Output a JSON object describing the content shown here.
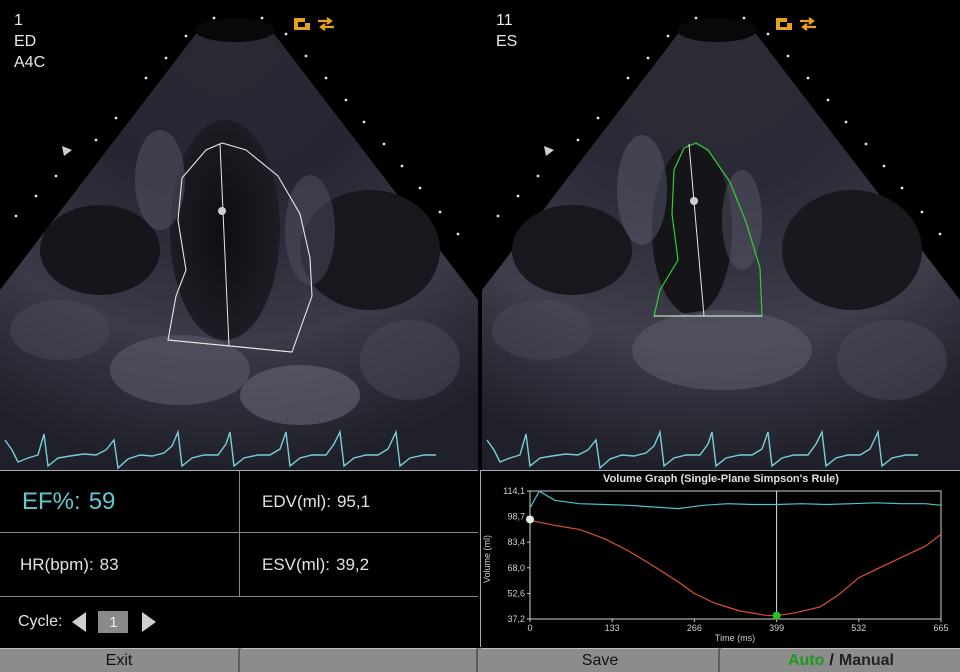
{
  "left_view": {
    "frame": "1",
    "phase": "ED",
    "view": "A4C"
  },
  "right_view": {
    "frame": "11",
    "phase": "ES"
  },
  "icons": {
    "probe": "probe-orientation-icon",
    "flip": "flip-swap-icon",
    "marker": "orientation-marker-icon"
  },
  "results": {
    "ef_label": "EF%:",
    "ef_value": "59",
    "edv_label": "EDV(ml):",
    "edv_value": "95,1",
    "hr_label": "HR(bpm):",
    "hr_value": "83",
    "esv_label": "ESV(ml):",
    "esv_value": "39,2"
  },
  "cycle": {
    "label": "Cycle:",
    "value": "1"
  },
  "graph": {
    "title": "Volume Graph (Single-Plane Simpson's Rule)",
    "ylabel": "Volume (ml)",
    "xlabel": "Time (ms)",
    "cursor_time": 399
  },
  "chart_data": {
    "type": "line",
    "title": "Volume Graph (Single-Plane Simpson's Rule)",
    "xlabel": "Time (ms)",
    "ylabel": "Volume (ml)",
    "xlim": [
      0,
      665
    ],
    "ylim": [
      37.2,
      114.1
    ],
    "x_ticks": [
      "0",
      "133",
      "266",
      "399",
      "532",
      "665"
    ],
    "y_ticks": [
      "114,1",
      "98,7",
      "83,4",
      "68,0",
      "52,6",
      "37,2"
    ],
    "series": [
      {
        "color": "#d9532c",
        "x": [
          0,
          40,
          80,
          120,
          160,
          200,
          240,
          266,
          300,
          340,
          380,
          399,
          430,
          470,
          500,
          532,
          560,
          600,
          640,
          665
        ],
        "y": [
          96.5,
          93.5,
          91.0,
          85.5,
          78.0,
          69.0,
          59.5,
          52.5,
          46.5,
          42.0,
          39.5,
          39.2,
          41.0,
          44.5,
          52.0,
          62.0,
          67.0,
          74.0,
          81.0,
          88.0
        ]
      },
      {
        "color": "#4fc4cf",
        "x": [
          0,
          15,
          40,
          80,
          120,
          160,
          200,
          240,
          280,
          320,
          360,
          399,
          440,
          480,
          520,
          560,
          600,
          640,
          665
        ],
        "y": [
          104.0,
          114.0,
          108.5,
          106.5,
          106.0,
          105.5,
          104.5,
          103.5,
          105.5,
          106.5,
          106.0,
          106.0,
          106.5,
          106.0,
          106.5,
          107.0,
          106.5,
          106.5,
          105.5
        ]
      }
    ],
    "markers": [
      {
        "x": 0,
        "y": 97.0,
        "color": "#e8e8e8"
      },
      {
        "x": 399,
        "y": 39.2,
        "color": "#22c322"
      }
    ],
    "grid": false
  },
  "buttons": {
    "exit": "Exit",
    "save": "Save",
    "auto": "Auto",
    "sep": "/",
    "manual": "Manual"
  }
}
